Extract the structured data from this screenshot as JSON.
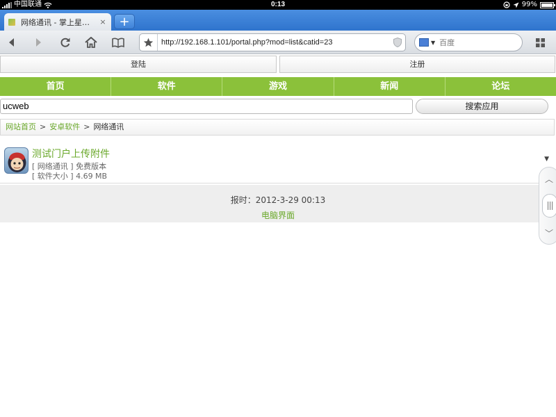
{
  "status_bar": {
    "carrier": "中国联通",
    "time": "0:13",
    "battery": "99%",
    "battery_level": 0.99
  },
  "browser": {
    "tab_title": "网络通讯 - 掌上星…",
    "tab_close": "×",
    "new_tab": "+",
    "url": "http://192.168.1.101/portal.php?mod=list&catid=23",
    "search_placeholder": "百度",
    "icons": [
      "back-icon",
      "forward-icon",
      "refresh-icon",
      "home-icon",
      "bookmarks-icon",
      "star-icon",
      "shield-icon",
      "search-engine-icon",
      "grid-menu-icon"
    ]
  },
  "page": {
    "login_label": "登陆",
    "register_label": "注册",
    "nav": [
      "首页",
      "软件",
      "游戏",
      "新闻",
      "论坛"
    ],
    "search_value": "ucweb",
    "search_button": "搜索应用",
    "breadcrumb": {
      "home": "网站首页",
      "separator": ">",
      "category": "安卓软件",
      "current": "网络通讯"
    },
    "item": {
      "title": "测试门户上传附件",
      "category_line": "[ 网络通讯 ] 免费版本",
      "size_line": "[ 软件大小 ] 4.69 MB"
    },
    "footer": {
      "time": "报时：2012-3-29 00:13",
      "pc_link": "电脑界面"
    }
  },
  "colors": {
    "accent": "#8bc13a",
    "link": "#6aa82a",
    "tab_strip": "#3a7fd5"
  }
}
